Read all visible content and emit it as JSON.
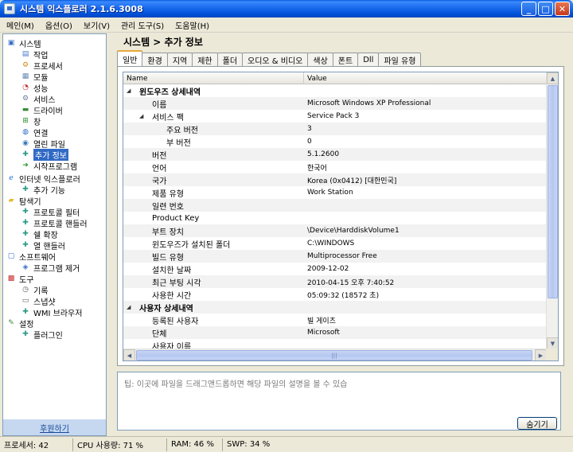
{
  "window": {
    "title": "시스템 익스플로러 2.1.6.3008",
    "btn_min": "_",
    "btn_max": "□",
    "btn_close": "✕"
  },
  "menu": [
    "메인(M)",
    "옵션(O)",
    "보기(V)",
    "관리 도구(S)",
    "도움말(H)"
  ],
  "sidebar": {
    "items": [
      {
        "label": "시스템",
        "icon": "computer-icon",
        "glyph": "▣",
        "color": "#3a6fc8"
      },
      {
        "label": "작업",
        "icon": "task-icon",
        "glyph": "▤",
        "color": "#4a7ac8"
      },
      {
        "label": "프로세서",
        "icon": "gear-icon",
        "glyph": "⚙",
        "color": "#d08a20"
      },
      {
        "label": "모듈",
        "icon": "module-icon",
        "glyph": "▦",
        "color": "#6a8ab8"
      },
      {
        "label": "성능",
        "icon": "performance-icon",
        "glyph": "◔",
        "color": "#c83030"
      },
      {
        "label": "서비스",
        "icon": "service-gear-icon",
        "glyph": "⚙",
        "color": "#6a7a9a"
      },
      {
        "label": "드라이버",
        "icon": "driver-icon",
        "glyph": "▬",
        "color": "#3a8a3a"
      },
      {
        "label": "창",
        "icon": "windows-flag-icon",
        "glyph": "⊞",
        "color": "#2a8a2a"
      },
      {
        "label": "연결",
        "icon": "globe-icon",
        "glyph": "◍",
        "color": "#2a6ac8"
      },
      {
        "label": "열린 파일",
        "icon": "open-file-icon",
        "glyph": "◉",
        "color": "#3a7ab8"
      },
      {
        "label": "추가 정보",
        "icon": "puzzle-icon",
        "glyph": "✚",
        "color": "#2a9a8a"
      },
      {
        "label": "시작프로그램",
        "icon": "startup-arrow-icon",
        "glyph": "➜",
        "color": "#2a9a2a"
      },
      {
        "label": "인터넷 익스플로러",
        "icon": "internet-explorer-icon",
        "glyph": "ℯ",
        "color": "#1a6ad8"
      },
      {
        "label": "추가 기능",
        "icon": "addon-puzzle-icon",
        "glyph": "✚",
        "color": "#2a9a8a"
      },
      {
        "label": "탐색기",
        "icon": "folder-icon",
        "glyph": "▰",
        "color": "#e8b830"
      },
      {
        "label": "프로토콜 필터",
        "icon": "protocol-filter-icon",
        "glyph": "✚",
        "color": "#2a9a8a"
      },
      {
        "label": "프로토콜 핸들러",
        "icon": "protocol-handler-icon",
        "glyph": "✚",
        "color": "#2a9a8a"
      },
      {
        "label": "쉘 확장",
        "icon": "shell-extension-icon",
        "glyph": "✚",
        "color": "#2a9a8a"
      },
      {
        "label": "열 핸들러",
        "icon": "column-handler-icon",
        "glyph": "✚",
        "color": "#2a9a8a"
      },
      {
        "label": "소프트웨어",
        "icon": "software-icon",
        "glyph": "▢",
        "color": "#3a6fc8"
      },
      {
        "label": "프로그램 제거",
        "icon": "uninstall-icon",
        "glyph": "◈",
        "color": "#3a6fc8"
      },
      {
        "label": "도구",
        "icon": "toolbox-icon",
        "glyph": "▩",
        "color": "#c83030"
      },
      {
        "label": "기록",
        "icon": "clock-icon",
        "glyph": "◷",
        "color": "#5a5a5a"
      },
      {
        "label": "스냅샷",
        "icon": "camera-icon",
        "glyph": "▭",
        "color": "#5a5a5a"
      },
      {
        "label": "WMI 브라우저",
        "icon": "wmi-browser-icon",
        "glyph": "✚",
        "color": "#2a9a8a"
      },
      {
        "label": "설정",
        "icon": "wrench-icon",
        "glyph": "✎",
        "color": "#3a8a3a"
      },
      {
        "label": "플러그인",
        "icon": "plugin-puzzle-icon",
        "glyph": "✚",
        "color": "#2a9a8a"
      }
    ],
    "donate_label": "후원하기"
  },
  "breadcrumb": "시스템 > 추가 정보",
  "tabs": [
    "일반",
    "환경",
    "지역",
    "제한",
    "폴더",
    "오디오 & 비디오",
    "색상",
    "폰트",
    "Dll",
    "파일 유형"
  ],
  "grid": {
    "col_name": "Name",
    "col_value": "Value",
    "rows": [
      {
        "name": "윈도우즈 상세내역",
        "value": "",
        "level": 0,
        "group": true
      },
      {
        "name": "이름",
        "value": "Microsoft Windows XP Professional",
        "level": 1
      },
      {
        "name": "서비스 팩",
        "value": "Service Pack 3",
        "level": 1,
        "group_sub": true
      },
      {
        "name": "주요 버전",
        "value": "3",
        "level": 2
      },
      {
        "name": "부 버전",
        "value": "0",
        "level": 2
      },
      {
        "name": "버전",
        "value": "5.1.2600",
        "level": 1
      },
      {
        "name": "언어",
        "value": "한국어",
        "level": 1
      },
      {
        "name": "국가",
        "value": "Korea (0x0412) [대한민국]",
        "level": 1
      },
      {
        "name": "제품 유형",
        "value": "Work Station",
        "level": 1
      },
      {
        "name": "일련 번호",
        "value": "",
        "level": 1
      },
      {
        "name": "Product Key",
        "value": "",
        "level": 1
      },
      {
        "name": "부트 장치",
        "value": "\\Device\\HarddiskVolume1",
        "level": 1
      },
      {
        "name": "윈도우즈가 설치된 폴더",
        "value": "C:\\WINDOWS",
        "level": 1
      },
      {
        "name": "빌드 유형",
        "value": "Multiprocessor Free",
        "level": 1
      },
      {
        "name": "설치한 날짜",
        "value": "2009-12-02",
        "level": 1
      },
      {
        "name": "최근 부팅 시각",
        "value": "2010-04-15 오후 7:40:52",
        "level": 1
      },
      {
        "name": "사용한 시간",
        "value": "05:09:32 (18572 초)",
        "level": 1
      },
      {
        "name": "사용자 상세내역",
        "value": "",
        "level": 0,
        "group": true
      },
      {
        "name": "등록된 사용자",
        "value": "빌 게이츠",
        "level": 1
      },
      {
        "name": "단체",
        "value": "Microsoft",
        "level": 1
      },
      {
        "name": "사용자 이름",
        "value": "",
        "level": 1
      }
    ]
  },
  "tip": "팁: 이곳에 파일을 드래그앤드롭하면 해당 파일의 설명을 볼 수 있습",
  "hide_button": "숨기기",
  "status": {
    "processes": "프로세서: 42",
    "cpu": "CPU 사용량: 71 %",
    "ram": "RAM: 46 %",
    "swap": "SWP: 34 %"
  }
}
